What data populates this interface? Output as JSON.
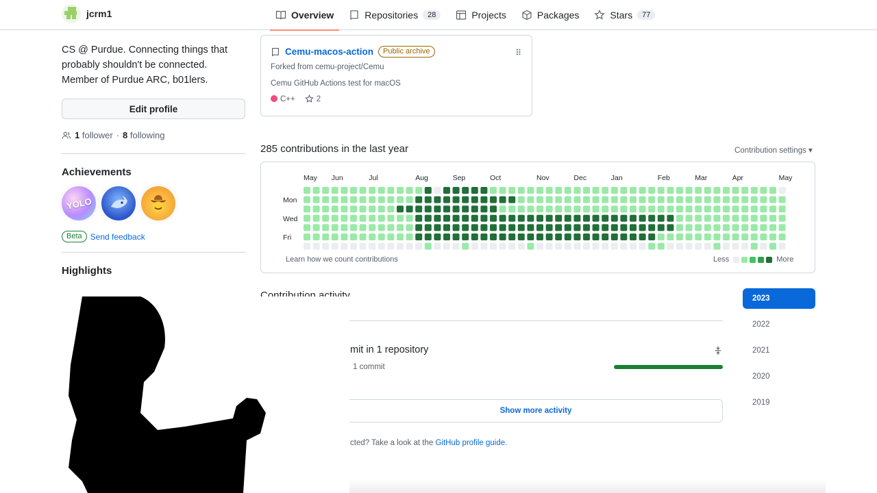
{
  "header": {
    "username": "jcrm1",
    "tabs": [
      {
        "label": "Overview",
        "count": "",
        "icon": "book-icon",
        "active": true
      },
      {
        "label": "Repositories",
        "count": "28",
        "icon": "repo-icon",
        "active": false
      },
      {
        "label": "Projects",
        "count": "",
        "icon": "table-icon",
        "active": false
      },
      {
        "label": "Packages",
        "count": "",
        "icon": "package-icon",
        "active": false
      },
      {
        "label": "Stars",
        "count": "77",
        "icon": "star-icon",
        "active": false
      }
    ]
  },
  "profile": {
    "bio": "CS @ Purdue. Connecting things that probably shouldn't be connected. Member of Purdue ARC, b01lers.",
    "edit_label": "Edit profile",
    "followers_count": "1",
    "followers_label": "follower",
    "following_count": "8",
    "following_label": "following",
    "separator": "·"
  },
  "achievements": {
    "title": "Achievements",
    "badges": [
      {
        "name": "yolo-badge",
        "text": "YOLO"
      },
      {
        "name": "shark-badge",
        "text": ""
      },
      {
        "name": "cowboy-badge",
        "text": ""
      }
    ],
    "beta_label": "Beta",
    "feedback_label": "Send feedback"
  },
  "highlights": {
    "title": "Highlights"
  },
  "pinned": {
    "repo_name": "Cemu-macos-action",
    "badge": "Public archive",
    "forked_from": "Forked from cemu-project/Cemu",
    "description": "Cemu GitHub Actions test for macOS",
    "language": "C++",
    "stars": "2"
  },
  "contributions": {
    "title": "285 contributions in the last year",
    "settings_label": "Contribution settings ▾",
    "months": [
      "May",
      "Jun",
      "Jul",
      "Aug",
      "Sep",
      "Oct",
      "Nov",
      "Dec",
      "Jan",
      "Feb",
      "Mar",
      "Apr",
      "May"
    ],
    "month_weeks": [
      0,
      3,
      7,
      12,
      16,
      20,
      25,
      29,
      33,
      38,
      42,
      46,
      51
    ],
    "day_labels": [
      "Mon",
      "Wed",
      "Fri"
    ],
    "day_label_rows": [
      1,
      3,
      5
    ],
    "learn_label": "Learn how we count contributions",
    "less_label": "Less",
    "more_label": "More",
    "colors": [
      "#ebedf0",
      "#9be9a8",
      "#40c463",
      "#30a14e",
      "#216e39"
    ],
    "grid_levels": [
      "1111111111111404444411111111111111111111111111111110",
      "1111111111114444444444411111111111111111111111111111",
      "1111111111444444444441111111111111111111111111111111",
      "1111111111114444444444444444444444444444111111111111",
      "1111111111114444444444444444444444444444111111111111",
      "1111111111114444444444444444444444444411111111111111",
      "0000000000000100010000001000000000000110000010001010"
    ]
  },
  "activity": {
    "title": "Contribution activity",
    "commit_summary": "mit in 1 repository",
    "commit_count": "1 commit",
    "progress": 1.0,
    "show_more": "Show more activity",
    "guide_text": "cted? Take a look at the ",
    "guide_link": "GitHub profile guide."
  },
  "years": [
    "2023",
    "2022",
    "2021",
    "2020",
    "2019"
  ],
  "selected_year": "2023"
}
